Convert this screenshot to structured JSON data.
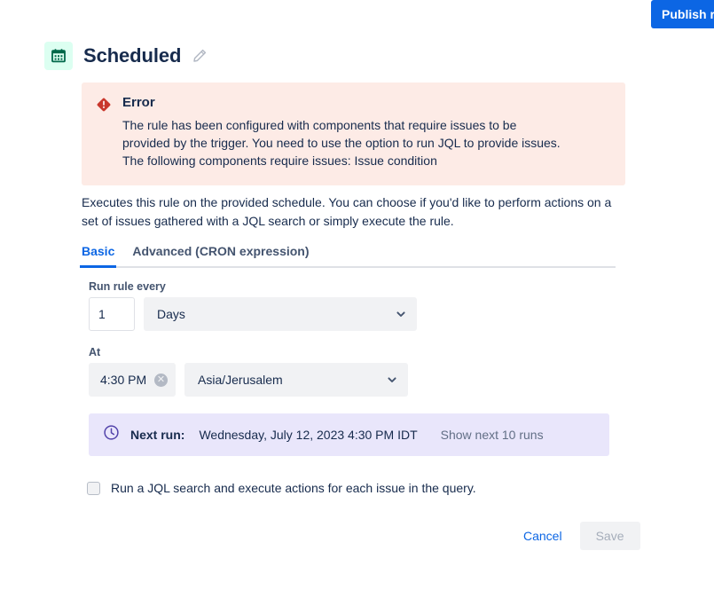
{
  "topbar": {
    "publish_label": "Publish rule"
  },
  "header": {
    "icon": "calendar-icon",
    "title": "Scheduled",
    "edit_icon": "pencil-icon"
  },
  "error": {
    "icon": "error-diamond-icon",
    "title": "Error",
    "message": "The rule has been configured with components that require issues to be provided by the trigger. You need to use the option to run JQL to provide issues. The following components require issues: Issue condition"
  },
  "description": "Executes this rule on the provided schedule. You can choose if you'd like to perform actions on a set of issues gathered with a JQL search or simply execute the rule.",
  "tabs": [
    {
      "label": "Basic",
      "active": true
    },
    {
      "label": "Advanced (CRON expression)",
      "active": false
    }
  ],
  "form": {
    "interval": {
      "label": "Run rule every",
      "value": "1",
      "unit": "Days"
    },
    "at": {
      "label": "At",
      "time": "4:30 PM",
      "clear_icon": "clear-circle-icon",
      "timezone": "Asia/Jerusalem"
    }
  },
  "next_run": {
    "icon": "clock-icon",
    "label": "Next run:",
    "value": "Wednesday, July 12, 2023 4:30 PM IDT",
    "show_more": "Show next 10 runs"
  },
  "jql_checkbox": {
    "checked": false,
    "label": "Run a JQL search and execute actions for each issue in the query."
  },
  "footer": {
    "cancel_label": "Cancel",
    "save_label": "Save",
    "save_disabled": true
  },
  "colors": {
    "primary": "#0c66e4",
    "error_bg": "#fdebe6",
    "error_icon": "#c9372c",
    "banner_bg": "#e9e6fb",
    "banner_icon": "#5243aa",
    "calendar_icon": "#00684a",
    "calendar_bg": "#dcfff1",
    "field_bg": "#f1f2f4",
    "text": "#172b4d",
    "subtle_text": "#626f86"
  }
}
